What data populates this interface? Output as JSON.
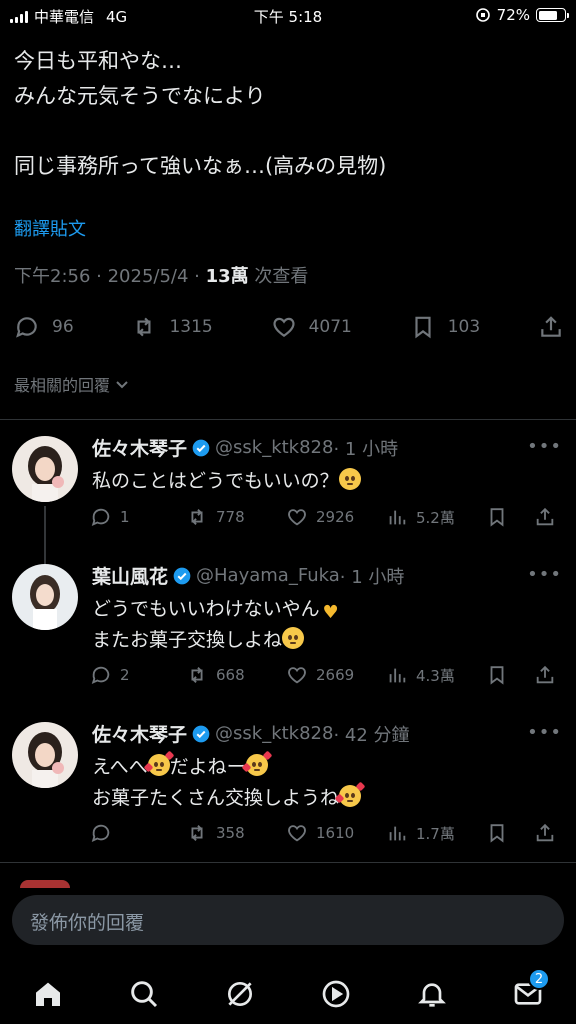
{
  "status_bar": {
    "carrier": "中華電信",
    "network": "4G",
    "time": "下午 5:18",
    "battery": "72%",
    "battery_level": 0.72
  },
  "post": {
    "lines": [
      "今日も平和やな…",
      "みんな元気そうでなにより",
      "",
      "同じ事務所って強いなぁ…(高みの見物)"
    ],
    "translate_label": "翻譯貼文",
    "timestamp": "下午2:56 · 2025/5/4 · ",
    "views_count": "13萬",
    "views_label": " 次查看",
    "replies": "96",
    "reposts": "1315",
    "likes": "4071",
    "bookmarks": "103"
  },
  "sort_label": "最相關的回覆",
  "replies": [
    {
      "name": "佐々木琴子",
      "handle": "@ssk_ktk828",
      "time": "· 1 小時",
      "text_lines": [
        "私のことはどうでもいいの？"
      ],
      "comments": "1",
      "reposts": "778",
      "likes": "2926",
      "views": "5.2萬"
    },
    {
      "name": "葉山風花",
      "handle": "@Hayama_Fuka",
      "time": "· 1 小時",
      "text_lines": [
        "どうでもいいわけないやん",
        "またお菓子交換しよね"
      ],
      "comments": "2",
      "reposts": "668",
      "likes": "2669",
      "views": "4.3萬"
    },
    {
      "name": "佐々木琴子",
      "handle": "@ssk_ktk828",
      "time": "· 42 分鐘",
      "text_lines": [
        "えへへ",
        "だよねー",
        "お菓子たくさん交換しようね"
      ],
      "comments": "",
      "reposts": "358",
      "likes": "1610",
      "views": "1.7萬"
    }
  ],
  "reply_input": {
    "placeholder": "發佈你的回覆"
  },
  "tab_bar": {
    "messages_badge": "2"
  },
  "colors": {
    "background": "#000000",
    "accent": "#1d9bf0",
    "muted": "#71767b",
    "text": "#e7e9ea"
  }
}
